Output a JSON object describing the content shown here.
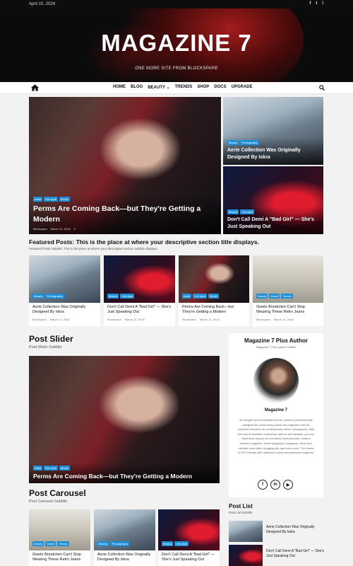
{
  "topbar": {
    "date": "April 10, 2024",
    "social": [
      "f",
      "t",
      "i"
    ]
  },
  "header": {
    "title": "MAGAZINE 7",
    "tagline": "ONE MORE SITE FROM BLOCKSPARE"
  },
  "nav": {
    "items": [
      "HOME",
      "BLOG",
      "BEAUTY ⌄",
      "TRENDS",
      "SHOP",
      "DOCS",
      "UPGRADE"
    ]
  },
  "hero_main": {
    "badges": [
      "Artist",
      "Life style",
      "Model"
    ],
    "title": "Perms Are Coming Back—but They're Getting a Modern",
    "author": "Blockspare",
    "date": "March 12, 2018",
    "comments": "0"
  },
  "hero_side": [
    {
      "badges": [
        "Beauty",
        "Photography"
      ],
      "title": "Aerie Collection Was Originally Designed By Iskra"
    },
    {
      "badges": [
        "Beauty",
        "Life style"
      ],
      "title": "Don't Call Demi A \"Bad Girl\" — She's Just Speaking Out"
    }
  ],
  "featured": {
    "title": "Featured Posts: This is the place at where your descriptive section title displays.",
    "subtitle": "Featured Posts Subtitle: This is the place at where your descriptive section subtitle displays.",
    "cards": [
      {
        "badges": [
          "Beauty",
          "Photography"
        ],
        "title": "Aerie Collection Was Originally Designed By Iskra",
        "author": "Blockspare",
        "date": "March 12, 2018"
      },
      {
        "badges": [
          "Beauty",
          "Life style"
        ],
        "title": "Don't Call Demi A \"Bad Girl\" — She's Just Speaking Out",
        "author": "Blockspare",
        "date": "March 12, 2018"
      },
      {
        "badges": [
          "Artist",
          "Life style",
          "Model"
        ],
        "title": "Perms Are Coming Back—but They're Getting a Modern",
        "author": "Blockspare",
        "date": "March 12, 2018"
      },
      {
        "badges": [
          "Beauty",
          "Model",
          "Trends"
        ],
        "title": "Gisele Bündchen Can't Stop Wearing These Retro Jeans",
        "author": "Blockspare",
        "date": "March 12, 2018"
      }
    ]
  },
  "post_slider": {
    "title": "Post Slider",
    "subtitle": "Post Slider Subtitle",
    "badges": [
      "Artist",
      "Life style",
      "Model"
    ],
    "slide_title": "Perms Are Coming Back—but They're Getting a Modern"
  },
  "post_carousel": {
    "title": "Post Carousel",
    "subtitle": "Post Carousel Subtitle",
    "cards": [
      {
        "badges": [
          "Beauty",
          "Model",
          "Trends"
        ],
        "title": "Gisele Bündchen Can't Stop Wearing These Retro Jeans"
      },
      {
        "badges": [
          "Beauty",
          "Photography"
        ],
        "title": "Aerie Collection Was Originally Designed By Iskra"
      },
      {
        "badges": [
          "Beauty",
          "Life style"
        ],
        "title": "Don't Call Demi A \"Bad Girl\" — She's Just Speaking Out"
      }
    ]
  },
  "author_widget": {
    "title": "Magazine 7 Plus Author",
    "subtitle": "Magazine 7 Plus Author Subtitle",
    "name": "Magazine 7",
    "description": "An elegant and minimalistic theme, which is predominantly designed for a well news portal and magazine with an immense research on contemporary online newspapers. With the help of available customizer options and widgets, you can implement layouts as a trending news journals, modern fashion magazine, travel blogging & magazine, clean and minimal news sites, blogging site and even more. The theme is SEO friendly with optimized codes and awesome supports.",
    "social": [
      "f",
      "in",
      "▶"
    ]
  },
  "post_list": {
    "title": "Post List",
    "subtitle": "Post List Subtitle",
    "items": [
      {
        "title": "Aerie Collection Was Originally Designed By Iskra"
      },
      {
        "title": "Don't Call Demi A \"Bad Girl\" — She's Just Speaking Out"
      }
    ]
  },
  "colors": {
    "accent": "#1e8fd9",
    "dark": "#0d0d0d"
  }
}
